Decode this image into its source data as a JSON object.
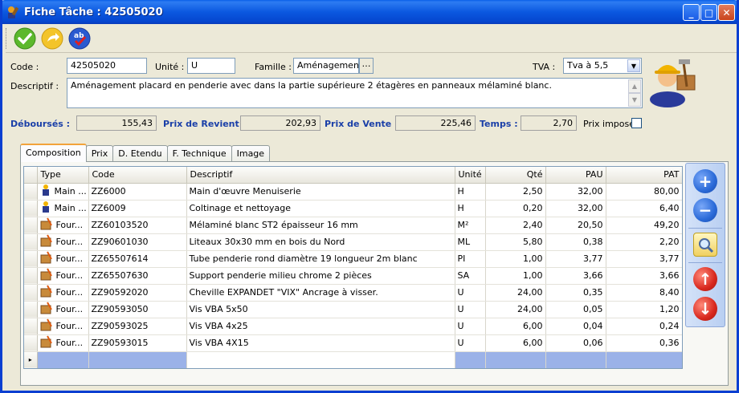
{
  "window": {
    "title": "Fiche Tâche : 42505020"
  },
  "form": {
    "code_label": "Code :",
    "code_value": "42505020",
    "unite_label": "Unité :",
    "unite_value": "U",
    "famille_label": "Famille :",
    "famille_value": "Aménagement p",
    "tva_label": "TVA :",
    "tva_value": "Tva à 5,5",
    "descriptif_label": "Descriptif :",
    "descriptif_value": "Aménagement placard en penderie avec dans la partie supérieure 2 étagères en panneaux mélaminé blanc."
  },
  "totals": {
    "debourses_label": "Déboursés :",
    "debourses_value": "155,43",
    "revient_label": "Prix de Revient :",
    "revient_value": "202,93",
    "vente_label": "Prix de Vente :",
    "vente_value": "225,46",
    "temps_label": "Temps :",
    "temps_value": "2,70",
    "impose_label": "Prix imposé"
  },
  "tabs": [
    "Composition",
    "Prix",
    "D. Etendu",
    "F. Technique",
    "Image"
  ],
  "table": {
    "headers": [
      "Type",
      "Code",
      "Descriptif",
      "Unité",
      "Qté",
      "PAU",
      "PAT"
    ],
    "rows": [
      {
        "icon": "worker-icon",
        "type": "Main ...",
        "code": "ZZ6000",
        "desc": "Main d'œuvre Menuiserie",
        "unit": "H",
        "qte": "2,50",
        "pau": "32,00",
        "pat": "80,00"
      },
      {
        "icon": "worker-icon",
        "type": "Main ...",
        "code": "ZZ6009",
        "desc": "Coltinage et nettoyage",
        "unit": "H",
        "qte": "0,20",
        "pau": "32,00",
        "pat": "6,40"
      },
      {
        "icon": "supply-icon",
        "type": "Four...",
        "code": "ZZ60103520",
        "desc": "Mélaminé blanc ST2 épaisseur 16 mm",
        "unit": "M²",
        "qte": "2,40",
        "pau": "20,50",
        "pat": "49,20"
      },
      {
        "icon": "supply-icon",
        "type": "Four...",
        "code": "ZZ90601030",
        "desc": "Liteaux 30x30 mm en bois du Nord",
        "unit": "ML",
        "qte": "5,80",
        "pau": "0,38",
        "pat": "2,20"
      },
      {
        "icon": "supply-icon",
        "type": "Four...",
        "code": "ZZ65507614",
        "desc": "Tube penderie rond diamètre 19 longueur 2m blanc",
        "unit": "PI",
        "qte": "1,00",
        "pau": "3,77",
        "pat": "3,77"
      },
      {
        "icon": "supply-icon",
        "type": "Four...",
        "code": "ZZ65507630",
        "desc": "Support penderie milieu chrome 2 pièces",
        "unit": "SA",
        "qte": "1,00",
        "pau": "3,66",
        "pat": "3,66"
      },
      {
        "icon": "supply-icon",
        "type": "Four...",
        "code": "ZZ90592020",
        "desc": "Cheville EXPANDET \"VIX\" Ancrage à visser.",
        "unit": "U",
        "qte": "24,00",
        "pau": "0,35",
        "pat": "8,40"
      },
      {
        "icon": "supply-icon",
        "type": "Four...",
        "code": "ZZ90593050",
        "desc": "Vis VBA 5x50",
        "unit": "U",
        "qte": "24,00",
        "pau": "0,05",
        "pat": "1,20"
      },
      {
        "icon": "supply-icon",
        "type": "Four...",
        "code": "ZZ90593025",
        "desc": "Vis VBA 4x25",
        "unit": "U",
        "qte": "6,00",
        "pau": "0,04",
        "pat": "0,24"
      },
      {
        "icon": "supply-icon",
        "type": "Four...",
        "code": "ZZ90593015",
        "desc": "Vis VBA 4X15",
        "unit": "U",
        "qte": "6,00",
        "pau": "0,06",
        "pat": "0,36"
      }
    ]
  },
  "colors": {
    "titlebar": "#0a5fe8",
    "label_blue": "#1a3fa8",
    "selected_row": "#9bb2e8",
    "add": "#2a6ad8",
    "up_down": "#d8281e"
  }
}
